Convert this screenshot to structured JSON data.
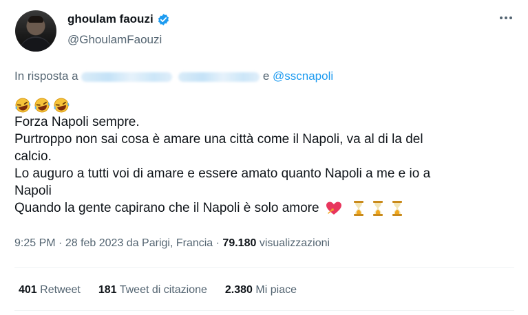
{
  "author": {
    "display_name": "ghoulam faouzi",
    "handle": "@GhoulamFaouzi",
    "verified": true
  },
  "reply": {
    "prefix": "In risposta a",
    "connector": "e",
    "mention": "@sscnapoli"
  },
  "tweet": {
    "lines": [
      "Forza Napoli sempre.",
      "Purtroppo non sai cosa è amare una città come il Napoli, va al di la del",
      "calcio.",
      "Lo auguro a tutti voi di amare e essere amato quanto Napoli a me e io a",
      "Napoli",
      "Quando la gente capirano che il Napoli è solo amore"
    ]
  },
  "meta": {
    "time": "9:25 PM",
    "sep1": "·",
    "date": "28 feb 2023 da Parigi, Francia",
    "sep2": "·",
    "views": "79.180",
    "views_label": "visualizzazioni"
  },
  "stats": {
    "retweets": "401",
    "retweets_label": "Retweet",
    "quotes": "181",
    "quotes_label": "Tweet di citazione",
    "likes": "2.380",
    "likes_label": "Mi piace"
  },
  "colors": {
    "accent": "#1d9bf0",
    "secondary_text": "#536471",
    "primary_text": "#0f1419"
  },
  "icons": [
    "verified-badge-icon",
    "more-options-icon",
    "laughing-emoji",
    "heart-emoji",
    "hourglass-emoji"
  ]
}
